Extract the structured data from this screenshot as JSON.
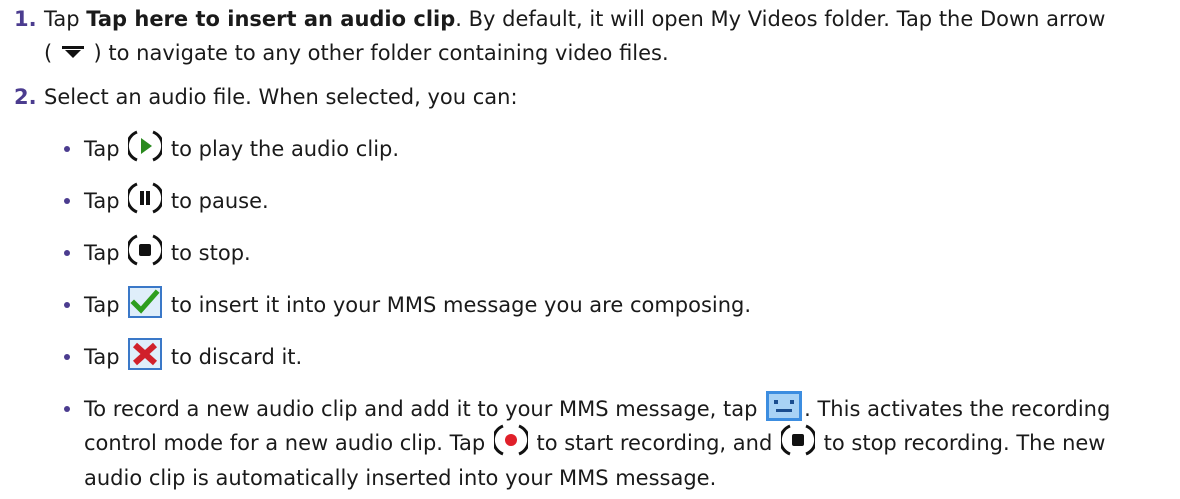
{
  "step1": {
    "number": "1.",
    "pre": "Tap ",
    "bold": "Tap here to insert an audio clip",
    "mid": ". By default, it will open My Videos folder. Tap the Down arrow",
    "line2_pre": "( ",
    "line2_post": " ) to navigate to any other folder containing video files."
  },
  "step2": {
    "number": "2.",
    "text": "Select an audio file. When selected, you can:"
  },
  "bullets": {
    "play": {
      "pre": "Tap ",
      "post": " to play the audio clip."
    },
    "pause": {
      "pre": "Tap ",
      "post": " to pause."
    },
    "stop": {
      "pre": "Tap ",
      "post": " to stop."
    },
    "insert": {
      "pre": "Tap ",
      "post": " to insert it into your MMS message you are composing."
    },
    "discard": {
      "pre": "Tap ",
      "post": " to discard it."
    },
    "record": {
      "pre": "To record a new audio clip and add it to your MMS message, tap ",
      "post": ". This activates the recording",
      "line2_pre": "control mode for a new audio clip. Tap ",
      "line2_mid": " to start recording, and ",
      "line2_post": " to stop recording. The new",
      "line3": "audio clip is automatically inserted into your MMS message."
    }
  },
  "icons": {
    "down_arrow": "down-arrow-icon",
    "play": "play-icon",
    "pause": "pause-icon",
    "stop": "stop-icon",
    "insert": "checkmark-icon",
    "discard": "close-icon",
    "record_mode": "voice-recorder-icon",
    "record": "record-icon"
  },
  "colors": {
    "step_number": "#4b3c8f",
    "play_green": "#2a8a1e",
    "record_red": "#e0202a"
  }
}
